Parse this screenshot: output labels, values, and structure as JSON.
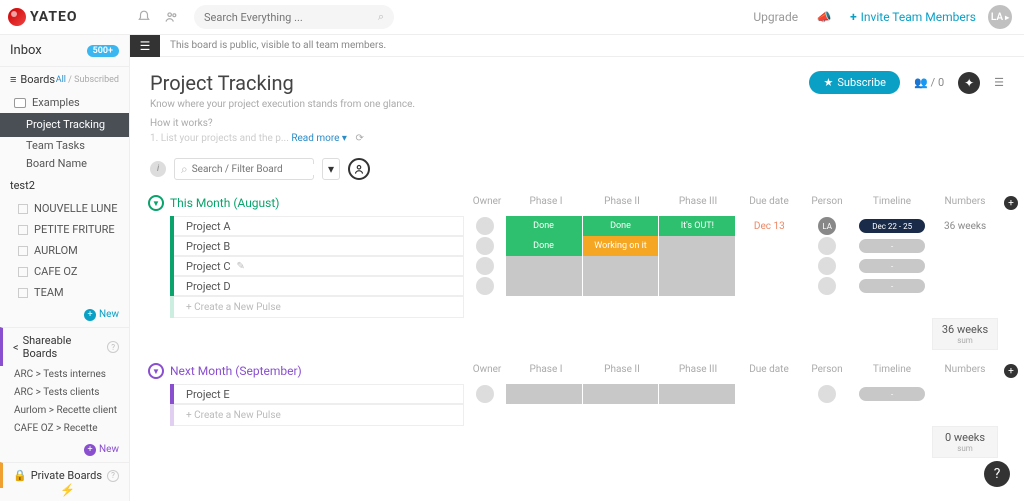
{
  "brand": {
    "name": "YATEO"
  },
  "top": {
    "search_placeholder": "Search Everything ...",
    "upgrade": "Upgrade",
    "invite": "Invite Team Members",
    "avatar_initials": "LA"
  },
  "sidebar": {
    "inbox_label": "Inbox",
    "inbox_badge": "500+",
    "boards_label": "Boards",
    "filter_all": "All",
    "filter_sub": "Subscribed",
    "examples_folder": "Examples",
    "examples_children": [
      "Project Tracking",
      "Team Tasks",
      "Board Name"
    ],
    "group2_label": "test2",
    "group2_items": [
      "NOUVELLE LUNE",
      "PETITE FRITURE",
      "AURLOM",
      "CAFE OZ",
      "TEAM"
    ],
    "new_label": "New",
    "shareable_label": "Shareable Boards",
    "shareable_items": [
      "ARC > Tests internes",
      "ARC > Tests clients",
      "Aurlom > Recette client",
      "CAFE OZ > Recette"
    ],
    "private_label": "Private Boards"
  },
  "banner": {
    "text": "This board is public, visible to all team members."
  },
  "board": {
    "title": "Project Tracking",
    "desc": "Know where your project execution stands from one glance.",
    "how_works": "How it works?",
    "blurb_pre": "1. List your projects and the p...",
    "read_more": "Read more",
    "subscribe": "Subscribe",
    "members_count": "/ 0",
    "filter_placeholder": "Search / Filter Board"
  },
  "columns": {
    "owner": "Owner",
    "phase1": "Phase I",
    "phase2": "Phase II",
    "phase3": "Phase III",
    "due": "Due date",
    "person": "Person",
    "timeline": "Timeline",
    "numbers": "Numbers"
  },
  "g1": {
    "title": "This Month (August)",
    "rows": [
      {
        "name": "Project A",
        "p1": "Done",
        "p2": "Done",
        "p3": "It's OUT!",
        "due": "Dec 13",
        "person": "LA",
        "timeline": "Dec 22 - 25",
        "numbers": "36 weeks"
      },
      {
        "name": "Project B",
        "p1": "Done",
        "p2": "Working on it",
        "p3": "",
        "due": "",
        "person": "",
        "timeline": "-",
        "numbers": ""
      },
      {
        "name": "Project C",
        "p1": "",
        "p2": "",
        "p3": "",
        "due": "",
        "person": "",
        "timeline": "-",
        "numbers": ""
      },
      {
        "name": "Project D",
        "p1": "",
        "p2": "",
        "p3": "",
        "due": "",
        "person": "",
        "timeline": "-",
        "numbers": ""
      }
    ],
    "create": "+ Create a New Pulse",
    "sum_main": "36 weeks",
    "sum_sub": "sum"
  },
  "g2": {
    "title": "Next Month (September)",
    "rows": [
      {
        "name": "Project E",
        "p1": "",
        "p2": "",
        "p3": "",
        "due": "",
        "person": "",
        "timeline": "-",
        "numbers": ""
      }
    ],
    "create": "+ Create a New Pulse",
    "sum_main": "0 weeks",
    "sum_sub": "sum"
  }
}
